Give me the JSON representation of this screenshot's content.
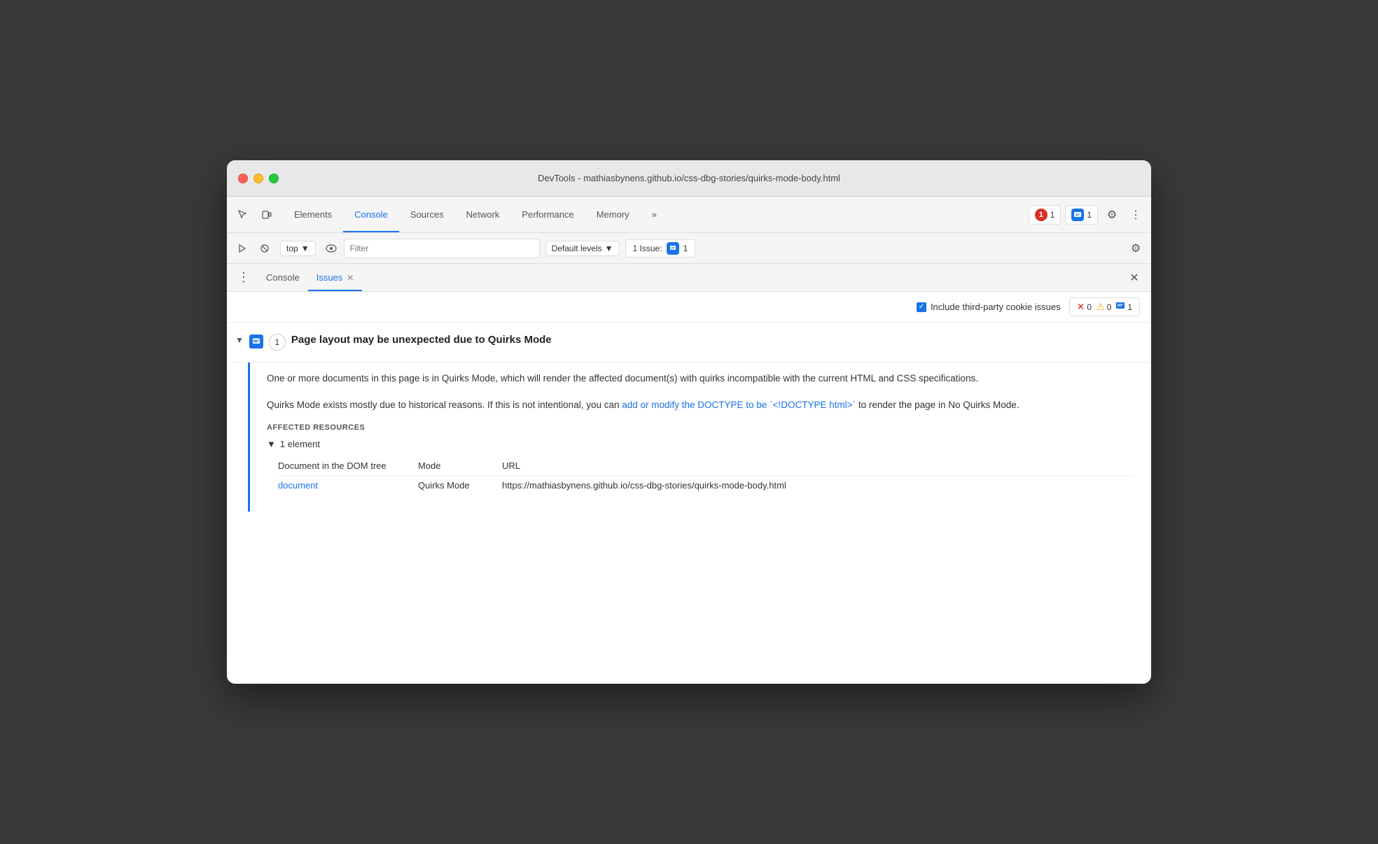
{
  "window": {
    "title": "DevTools - mathiasbynens.github.io/css-dbg-stories/quirks-mode-body.html"
  },
  "toolbar": {
    "tabs": [
      "Elements",
      "Console",
      "Sources",
      "Network",
      "Performance",
      "Memory",
      "more_label"
    ],
    "active_tab": "Console",
    "error_count": "1",
    "message_count": "1",
    "settings_label": "⚙",
    "dots_label": "⋮"
  },
  "console_toolbar": {
    "context": "top",
    "filter_placeholder": "Filter",
    "levels_label": "Default levels",
    "issue_label": "1 Issue:",
    "issue_count": "1"
  },
  "sub_tabs": {
    "items": [
      "Console",
      "Issues"
    ],
    "active": "Issues"
  },
  "issues_panel": {
    "include_third_party": "Include third-party cookie issues",
    "error_count": "0",
    "warning_count": "0",
    "info_count": "1",
    "issue": {
      "title": "Page layout may be unexpected due to Quirks Mode",
      "count": "1",
      "description1": "One or more documents in this page is in Quirks Mode, which will render the affected document(s) with quirks incompatible with the current HTML and CSS specifications.",
      "description2_before": "Quirks Mode exists mostly due to historical reasons. If this is not intentional, you can ",
      "link_text": "add or modify the DOCTYPE to be `<!DOCTYPE html>`",
      "description2_after": " to render the page in No Quirks Mode.",
      "link_href": "https://developer.mozilla.org/en-US/docs/Web/HTML/Quirks_Mode_and_Standards_Mode",
      "affected_label": "AFFECTED RESOURCES",
      "element_count": "1 element",
      "table_headers": [
        "Document in the DOM tree",
        "Mode",
        "URL"
      ],
      "table_row": {
        "col1": "document",
        "col2": "Quirks Mode",
        "col3": "https://mathiasbynens.github.io/css-dbg-stories/quirks-mode-body.html"
      }
    }
  }
}
